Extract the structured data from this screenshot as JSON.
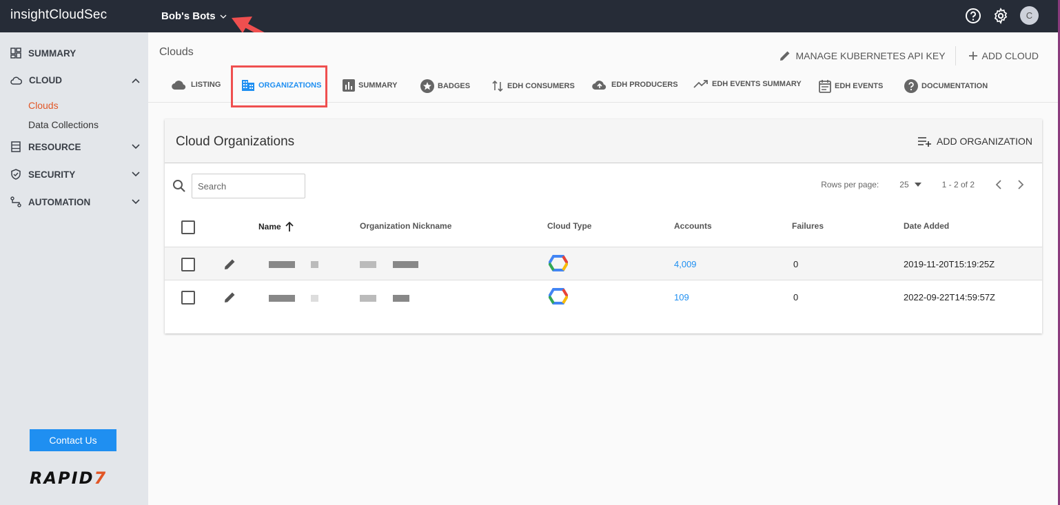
{
  "topbar": {
    "brand_light": "insight",
    "brand_bold": "CloudSec",
    "org_name": "Bob's Bots",
    "avatar_initial": "C"
  },
  "sidebar": {
    "items": [
      {
        "label": "SUMMARY",
        "icon": "dashboard-icon"
      },
      {
        "label": "CLOUD",
        "icon": "cloud-icon",
        "expanded": true
      },
      {
        "label": "RESOURCE",
        "icon": "database-icon"
      },
      {
        "label": "SECURITY",
        "icon": "shield-icon"
      },
      {
        "label": "AUTOMATION",
        "icon": "flow-icon"
      }
    ],
    "cloud_sub": [
      {
        "label": "Clouds",
        "active": true
      },
      {
        "label": "Data Collections"
      }
    ],
    "contact_label": "Contact Us",
    "logo_text": "RAPID",
    "logo_seven": "7"
  },
  "header": {
    "title": "Clouds",
    "manage_k8s_label": "MANAGE KUBERNETES API KEY",
    "add_cloud_label": "ADD CLOUD"
  },
  "tabs": [
    {
      "label": "LISTING",
      "icon": "cloud-icon"
    },
    {
      "label": "ORGANIZATIONS",
      "icon": "building-icon",
      "active": true
    },
    {
      "label": "SUMMARY",
      "icon": "bar-chart-icon"
    },
    {
      "label": "BADGES",
      "icon": "star-badge-icon"
    },
    {
      "label": "EDH CONSUMERS",
      "icon": "swap-vertical-icon"
    },
    {
      "label": "EDH PRODUCERS",
      "icon": "cloud-upload-icon"
    },
    {
      "label": "EDH EVENTS SUMMARY",
      "icon": "trending-up-icon"
    },
    {
      "label": "EDH EVENTS",
      "icon": "calendar-icon"
    },
    {
      "label": "DOCUMENTATION",
      "icon": "help-circle-icon"
    }
  ],
  "card": {
    "title": "Cloud Organizations",
    "add_org_label": "ADD ORGANIZATION",
    "search_placeholder": "Search",
    "rows_per_page_label": "Rows per page:",
    "rows_per_page_value": "25",
    "range_label": "1 - 2 of 2",
    "columns": [
      "Name",
      "Organization Nickname",
      "Cloud Type",
      "Accounts",
      "Failures",
      "Date Added"
    ],
    "rows": [
      {
        "accounts": "4,009",
        "failures": "0",
        "date_added": "2019-11-20T15:19:25Z",
        "cloud_type": "gcp-icon"
      },
      {
        "accounts": "109",
        "failures": "0",
        "date_added": "2022-09-22T14:59:57Z",
        "cloud_type": "gcp-icon"
      }
    ]
  },
  "colors": {
    "topbar": "#262c37",
    "accent": "#1f8ff1",
    "active_nav": "#e25626",
    "highlight": "#ef4f4f"
  }
}
